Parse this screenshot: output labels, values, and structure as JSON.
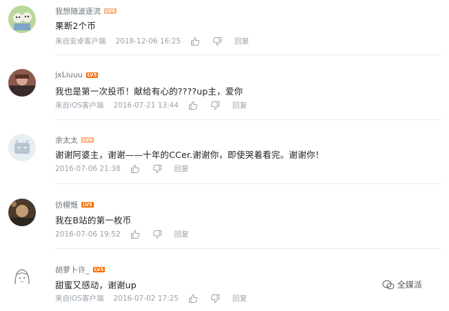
{
  "comments": [
    {
      "username": "我想随波逐流",
      "level": "LV4",
      "text": "果断2个币",
      "source": "来自安卓客户端",
      "time": "2018-12-06 16:25",
      "reply": "回复"
    },
    {
      "username": "jxLiuuu",
      "level": "LV5",
      "text": "我也是第一次投币！献给有心的????up主，爱你",
      "source": "来自iOS客户端",
      "time": "2016-07-21 13:44",
      "reply": "回复"
    },
    {
      "username": "余太太",
      "level": "LV4",
      "text": "谢谢阿婆主，谢谢——十年的CCer.谢谢你，即使哭着看完。谢谢你！",
      "source": "",
      "time": "2016-07-06 21:38",
      "reply": "回复"
    },
    {
      "username": "彷幌慨",
      "level": "LV5",
      "text": "我在B站的第一枚币",
      "source": "",
      "time": "2016-07-06 19:52",
      "reply": "回复"
    },
    {
      "username": "胡萝卜许_",
      "level": "LV5",
      "text": "甜蜜又感动，谢谢up",
      "source": "来自iOS客户端",
      "time": "2016-07-02 17:25",
      "reply": "回复"
    }
  ],
  "watermark": {
    "text": "全媒派"
  }
}
